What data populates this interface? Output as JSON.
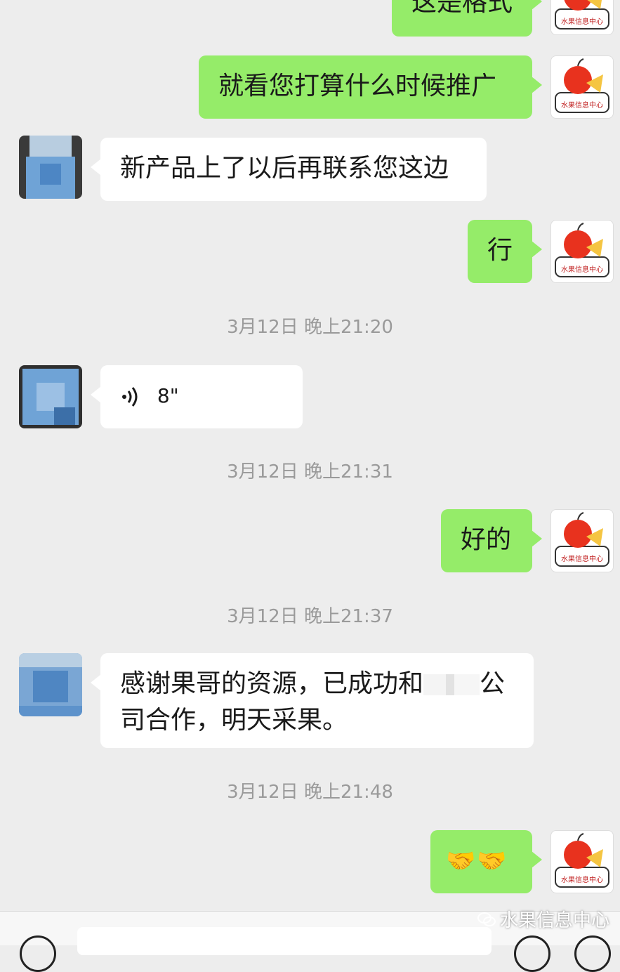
{
  "chat": {
    "messages": [
      {
        "sender": "me",
        "text": "这是格式"
      },
      {
        "sender": "me",
        "text": "就看您打算什么时候推广"
      },
      {
        "sender": "other",
        "text": "新产品上了以后再联系您这边"
      },
      {
        "sender": "me",
        "text": "行"
      },
      {
        "type": "timestamp",
        "text": "3月12日 晚上21:20"
      },
      {
        "sender": "other",
        "type": "voice",
        "duration": "8\""
      },
      {
        "type": "timestamp",
        "text": "3月12日 晚上21:31"
      },
      {
        "sender": "me",
        "text": "好的"
      },
      {
        "type": "timestamp",
        "text": "3月12日 晚上21:37"
      },
      {
        "sender": "other",
        "text_part1": "感谢果哥的资源，已成功和",
        "text_part2": "公司合作，明天采果。"
      },
      {
        "type": "timestamp",
        "text": "3月12日 晚上21:48"
      },
      {
        "sender": "me",
        "text": "🤝🤝"
      }
    ]
  },
  "avatar": {
    "me_label": "水果信息中心",
    "colors": {
      "apple": "#e8321e",
      "slice": "#f5c542",
      "other_blur": "#6fa3d6"
    }
  },
  "watermark": {
    "text": "水果信息中心"
  },
  "colors": {
    "bubble_me": "#95ec69",
    "bubble_other": "#ffffff",
    "bg": "#ededed"
  }
}
